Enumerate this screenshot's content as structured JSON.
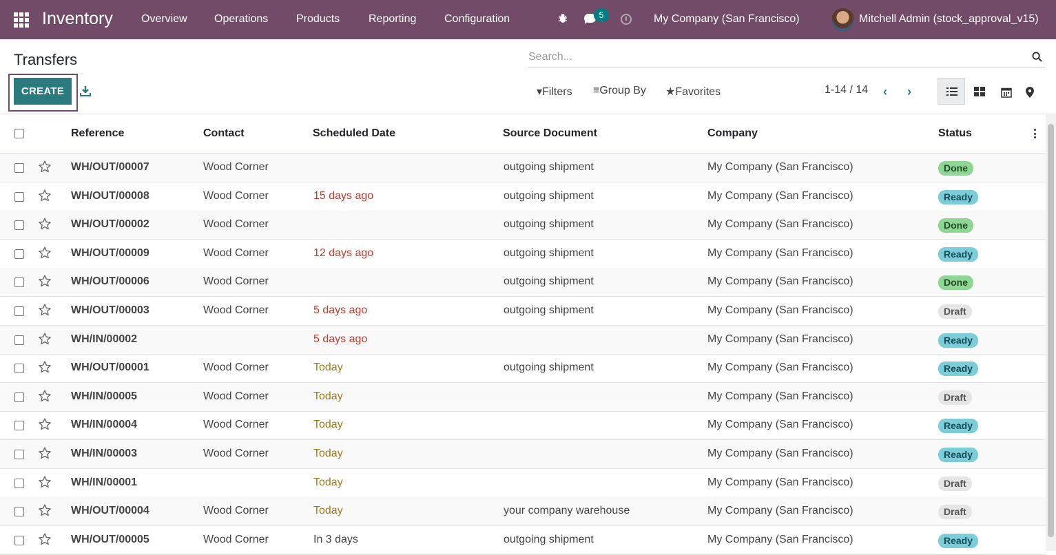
{
  "navbar": {
    "app_name": "Inventory",
    "menu": [
      "Overview",
      "Operations",
      "Products",
      "Reporting",
      "Configuration"
    ],
    "message_count": "5",
    "company": "My Company (San Francisco)",
    "user": "Mitchell Admin (stock_approval_v15)"
  },
  "page": {
    "title": "Transfers",
    "create_label": "CREATE",
    "search_placeholder": "Search...",
    "filters_label": "Filters",
    "group_by_label": "Group By",
    "favorites_label": "Favorites",
    "pager": "1-14 / 14"
  },
  "table": {
    "columns": [
      "Reference",
      "Contact",
      "Scheduled Date",
      "Source Document",
      "Company",
      "Status"
    ],
    "rows": [
      {
        "reference": "WH/OUT/00007",
        "contact": "Wood Corner",
        "date": "",
        "date_state": "none",
        "source": "outgoing shipment",
        "company": "My Company (San Francisco)",
        "status": "Done"
      },
      {
        "reference": "WH/OUT/00008",
        "contact": "Wood Corner",
        "date": "15 days ago",
        "date_state": "late",
        "source": "outgoing shipment",
        "company": "My Company (San Francisco)",
        "status": "Ready"
      },
      {
        "reference": "WH/OUT/00002",
        "contact": "Wood Corner",
        "date": "",
        "date_state": "none",
        "source": "outgoing shipment",
        "company": "My Company (San Francisco)",
        "status": "Done"
      },
      {
        "reference": "WH/OUT/00009",
        "contact": "Wood Corner",
        "date": "12 days ago",
        "date_state": "late",
        "source": "outgoing shipment",
        "company": "My Company (San Francisco)",
        "status": "Ready"
      },
      {
        "reference": "WH/OUT/00006",
        "contact": "Wood Corner",
        "date": "",
        "date_state": "none",
        "source": "outgoing shipment",
        "company": "My Company (San Francisco)",
        "status": "Done"
      },
      {
        "reference": "WH/OUT/00003",
        "contact": "Wood Corner",
        "date": "5 days ago",
        "date_state": "late",
        "source": "outgoing shipment",
        "company": "My Company (San Francisco)",
        "status": "Draft"
      },
      {
        "reference": "WH/IN/00002",
        "contact": "",
        "date": "5 days ago",
        "date_state": "late",
        "source": "",
        "company": "My Company (San Francisco)",
        "status": "Ready"
      },
      {
        "reference": "WH/OUT/00001",
        "contact": "Wood Corner",
        "date": "Today",
        "date_state": "today",
        "source": "outgoing shipment",
        "company": "My Company (San Francisco)",
        "status": "Ready"
      },
      {
        "reference": "WH/IN/00005",
        "contact": "Wood Corner",
        "date": "Today",
        "date_state": "today",
        "source": "",
        "company": "My Company (San Francisco)",
        "status": "Draft"
      },
      {
        "reference": "WH/IN/00004",
        "contact": "Wood Corner",
        "date": "Today",
        "date_state": "today",
        "source": "",
        "company": "My Company (San Francisco)",
        "status": "Ready"
      },
      {
        "reference": "WH/IN/00003",
        "contact": "Wood Corner",
        "date": "Today",
        "date_state": "today",
        "source": "",
        "company": "My Company (San Francisco)",
        "status": "Ready"
      },
      {
        "reference": "WH/IN/00001",
        "contact": "",
        "date": "Today",
        "date_state": "today",
        "source": "",
        "company": "My Company (San Francisco)",
        "status": "Draft"
      },
      {
        "reference": "WH/OUT/00004",
        "contact": "Wood Corner",
        "date": "Today",
        "date_state": "today",
        "source": "your company warehouse",
        "company": "My Company (San Francisco)",
        "status": "Draft"
      },
      {
        "reference": "WH/OUT/00005",
        "contact": "Wood Corner",
        "date": "In 3 days",
        "date_state": "future",
        "source": "outgoing shipment",
        "company": "My Company (San Francisco)",
        "status": "Ready"
      }
    ]
  },
  "colors": {
    "navbar": "#714B67",
    "primary_button": "#2a7a7e",
    "done": "#8fd694",
    "ready": "#7ccdd8",
    "draft": "#e5e5e5",
    "late_date": "#c0392b",
    "today_date": "#9c7a1c"
  },
  "icons": {
    "apps": "apps-grid-icon",
    "debug": "bug-icon",
    "messages": "chat-icon",
    "activities": "clock-icon",
    "search": "search-icon",
    "download": "download-icon",
    "favorite": "star-icon"
  }
}
